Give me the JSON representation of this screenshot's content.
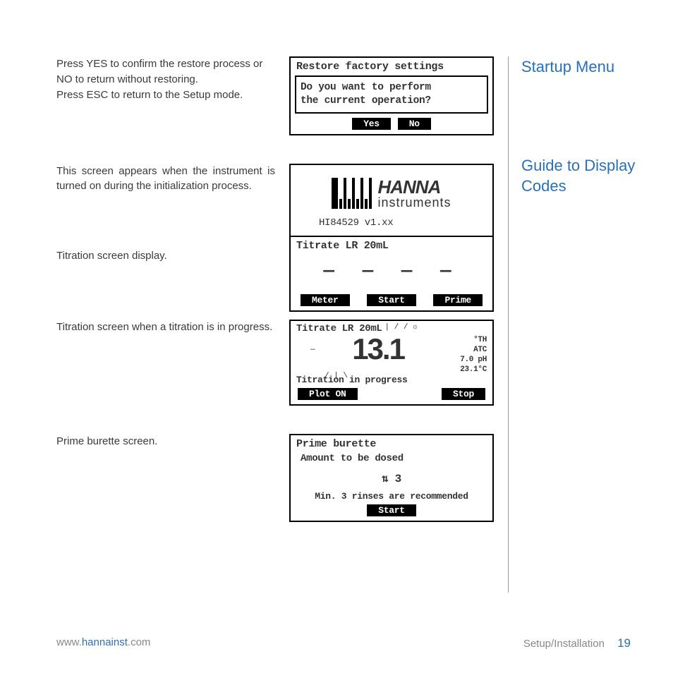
{
  "rows": {
    "restore": {
      "p1": "Press YES to confirm the restore process or NO to return without restoring.",
      "p2": "Press ESC to return to the Setup mode."
    },
    "startup": "This screen appears when the instrument is turned on during the initialization process.",
    "titrate": "Titration screen display.",
    "progress": "Titration screen when a titration is in progress.",
    "prime": "Prime burette screen."
  },
  "lcd": {
    "restore": {
      "title": "Restore factory settings",
      "prompt1": "Do you want to perform",
      "prompt2": "the current operation?",
      "yes": "Yes",
      "no": "No"
    },
    "startup": {
      "brand1": "HANNA",
      "brand2": "instruments",
      "model": "HI84529 v1.xx"
    },
    "titrate": {
      "title": "Titrate LR 20mL",
      "dashes": "— — — —",
      "btn_meter": "Meter",
      "btn_start": "Start",
      "btn_prime": "Prime"
    },
    "progress": {
      "title": "Titrate LR 20mL",
      "reading": "13.1",
      "unit": "°TH",
      "atc": "ATC",
      "ph": "7.0 pH",
      "temp": "23.1°C",
      "status": "Titration in progress",
      "btn_plot": "Plot ON",
      "btn_stop": "Stop"
    },
    "prime": {
      "title": "Prime burette",
      "amount_label": "Amount to be dosed",
      "value": "3",
      "rec": "Min. 3 rinses are recommended",
      "btn_start": "Start"
    }
  },
  "sidebar": {
    "h1": "Startup Menu",
    "h2": "Guide to Display Codes"
  },
  "footer": {
    "url_pre": "www.",
    "url_brand": "hannainst",
    "url_post": ".com",
    "section": "Setup/Installation",
    "page": "19"
  }
}
